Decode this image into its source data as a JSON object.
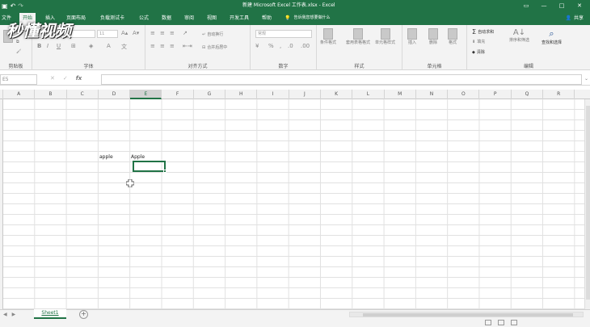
{
  "title_bar": {
    "title": "新建 Microsoft Excel 工作表.xlsx - Excel",
    "qat": {
      "save_icon": "save-icon",
      "undo_icon": "undo-icon",
      "redo_icon": "redo-icon"
    },
    "controls": [
      "▭",
      "—",
      "□",
      "✕"
    ]
  },
  "tabs": {
    "file": "文件",
    "home": "开始",
    "insert": "插入",
    "page_layout": "页面布局",
    "load_test": "负载测试卡",
    "formulas": "公式",
    "data": "数据",
    "review": "审阅",
    "view": "视图",
    "developer": "开发工具",
    "help": "帮助",
    "tell_me": "告诉我您想要做什么",
    "share": "共享"
  },
  "ribbon": {
    "clipboard": {
      "label": "剪贴板",
      "paste": "粘贴"
    },
    "font": {
      "label": "字体",
      "font_name": "",
      "font_size": "11",
      "bold": "B",
      "italic": "I",
      "underline": "U"
    },
    "alignment": {
      "label": "对齐方式",
      "wrap_text": "自动换行",
      "merge_center": "合并后居中"
    },
    "number": {
      "label": "数字",
      "format": "常规",
      "percent": "%"
    },
    "styles": {
      "label": "样式",
      "conditional": "条件格式",
      "as_table": "套用表格格式",
      "cell_styles": "单元格样式"
    },
    "cells": {
      "label": "单元格",
      "insert": "插入",
      "delete": "删除",
      "format": "格式"
    },
    "editing": {
      "label": "编辑",
      "autosum": "自动求和",
      "fill": "填充",
      "clear": "清除",
      "sort_filter": "排序和筛选",
      "find_select": "查找和选择"
    }
  },
  "formula_bar": {
    "name_box": "E5",
    "cancel": "✕",
    "enter": "✓",
    "fx": "fx",
    "content": ""
  },
  "grid": {
    "columns": [
      "A",
      "B",
      "C",
      "D",
      "E",
      "F",
      "G",
      "H",
      "I",
      "J",
      "K",
      "L",
      "M",
      "N",
      "O",
      "P",
      "Q",
      "R"
    ],
    "selected_column": "E",
    "cells": {
      "D4": "apple",
      "E4": "Apple"
    }
  },
  "sheets": {
    "tabs": [
      "Sheet1"
    ],
    "add_icon": "plus-icon"
  },
  "watermark": "秒懂视频"
}
